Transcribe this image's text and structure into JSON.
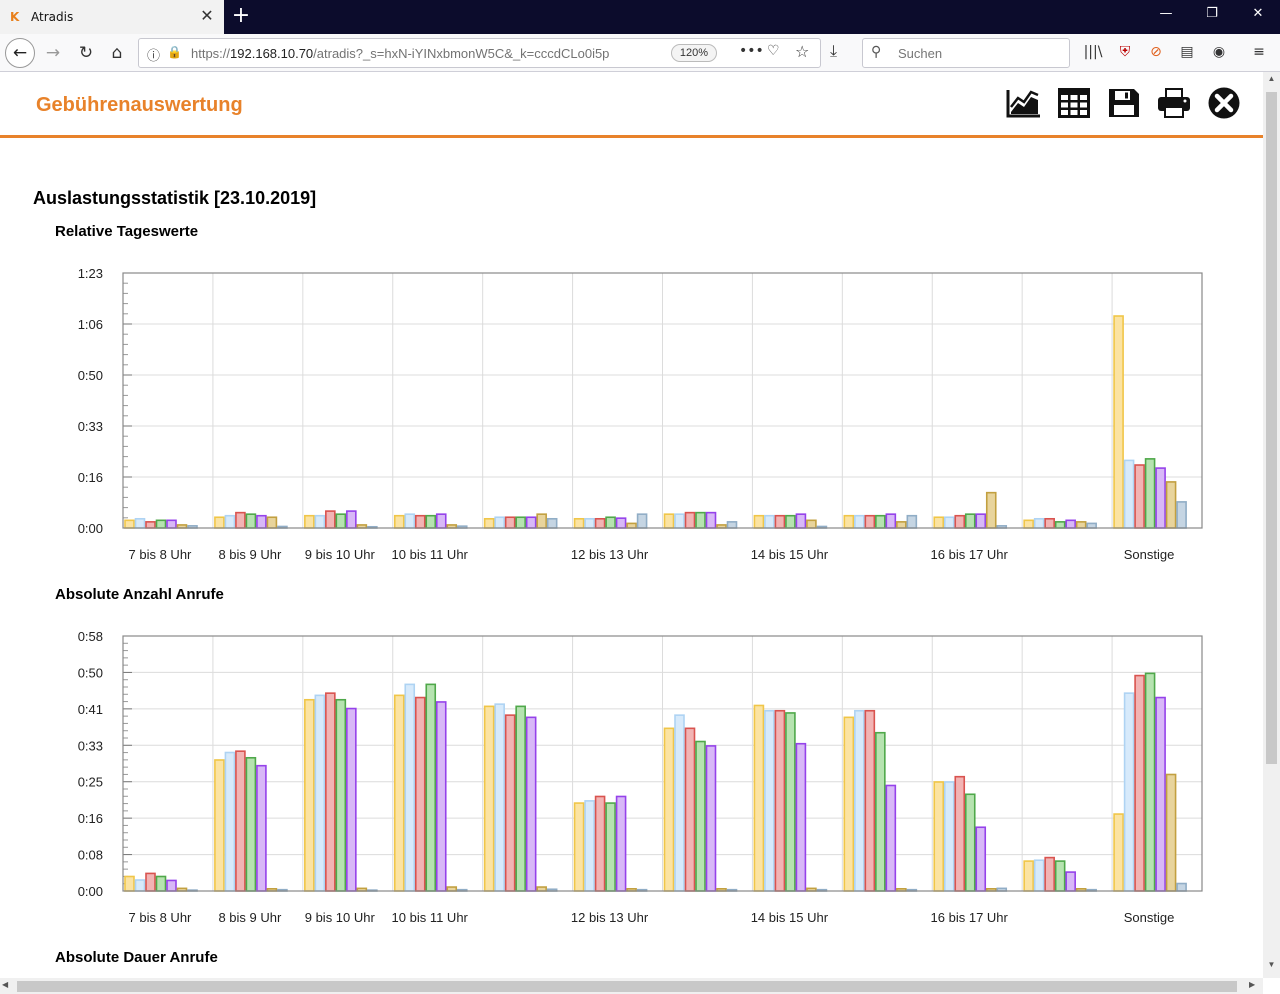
{
  "browser": {
    "tab_title": "Atradis",
    "tab_logo": "K",
    "url_scheme": "https://",
    "url_host": "192.168.10.70",
    "url_rest": "/atradis?_s=hxN-iYINxbmonW5C&_k=cccdCLo0i5p",
    "zoom": "120%",
    "search_placeholder": "Suchen"
  },
  "app": {
    "title": "Gebührenauswertung",
    "toolbar_icons": [
      "chart-icon",
      "table-icon",
      "save-icon",
      "print-icon",
      "close-icon"
    ]
  },
  "page": {
    "heading": "Auslastungsstatistik [23.10.2019]"
  },
  "colors": {
    "series": [
      {
        "fill": "#fbe3a2",
        "stroke": "#f0c648"
      },
      {
        "fill": "#d7eafb",
        "stroke": "#aed3f3"
      },
      {
        "fill": "#f2b4b4",
        "stroke": "#d9534f"
      },
      {
        "fill": "#b6e3b0",
        "stroke": "#4fa84a"
      },
      {
        "fill": "#d8b8f7",
        "stroke": "#9542ea"
      },
      {
        "fill": "#e8d49c",
        "stroke": "#c2a040"
      },
      {
        "fill": "#c5d5e3",
        "stroke": "#90adc6"
      }
    ]
  },
  "chart_data": [
    {
      "type": "bar",
      "title": "Relative Tageswerte",
      "categories": [
        "7 bis 8 Uhr",
        "8 bis 9 Uhr",
        "9 bis 10 Uhr",
        "10 bis 11 Uhr",
        "",
        "12 bis 13 Uhr",
        "",
        "14 bis 15 Uhr",
        "",
        "16 bis 17 Uhr",
        "",
        "Sonstige"
      ],
      "y_ticks": [
        "0:00",
        "0:16",
        "0:33",
        "0:50",
        "1:06",
        "1:23"
      ],
      "ylim": [
        0,
        83
      ],
      "grid": true,
      "series": [
        {
          "values": [
            2.5,
            3.5,
            4,
            4,
            3,
            3,
            4.5,
            4,
            4,
            3.5,
            2.5,
            69
          ]
        },
        {
          "values": [
            3,
            4,
            4,
            4.5,
            3.5,
            3,
            4.5,
            4,
            4,
            3.5,
            3,
            22
          ]
        },
        {
          "values": [
            2,
            5,
            5.5,
            4,
            3.5,
            3,
            5,
            4,
            4,
            4,
            3,
            20.5
          ]
        },
        {
          "values": [
            2.5,
            4.5,
            4.5,
            4,
            3.5,
            3.5,
            5,
            4,
            4,
            4.5,
            2,
            22.5
          ]
        },
        {
          "values": [
            2.5,
            4,
            5.5,
            4.5,
            3.5,
            3.2,
            5,
            4.5,
            4.5,
            4.5,
            2.5,
            19.5
          ]
        },
        {
          "values": [
            1,
            3.5,
            1,
            1,
            4.5,
            1.5,
            1,
            2.5,
            2,
            11.5,
            2,
            15
          ]
        },
        {
          "values": [
            0.7,
            0.5,
            0.4,
            0.6,
            3,
            4.5,
            2,
            0.5,
            4,
            0.7,
            1.5,
            8.5
          ]
        }
      ]
    },
    {
      "type": "bar",
      "title": "Absolute Anzahl Anrufe",
      "categories": [
        "7 bis 8 Uhr",
        "8 bis 9 Uhr",
        "9 bis 10 Uhr",
        "10 bis 11 Uhr",
        "",
        "12 bis 13 Uhr",
        "",
        "14 bis 15 Uhr",
        "",
        "16 bis 17 Uhr",
        "",
        "Sonstige"
      ],
      "y_ticks": [
        "0:00",
        "0:08",
        "0:16",
        "0:25",
        "0:33",
        "0:41",
        "0:50",
        "0:58"
      ],
      "ylim": [
        0,
        58
      ],
      "grid": true,
      "series": [
        {
          "values": [
            3.3,
            29.8,
            43.5,
            44.5,
            42,
            20,
            37,
            42.2,
            39.5,
            24.8,
            6.8,
            17.5
          ]
        },
        {
          "values": [
            2.5,
            31.5,
            44.5,
            47,
            42.5,
            20.5,
            40,
            41,
            41,
            24.8,
            7,
            45
          ]
        },
        {
          "values": [
            4,
            31.8,
            45,
            44,
            40,
            21.5,
            37,
            41,
            41,
            26,
            7.6,
            49
          ]
        },
        {
          "values": [
            3.3,
            30.3,
            43.5,
            47,
            42,
            20,
            34,
            40.5,
            36,
            22,
            6.8,
            49.5
          ]
        },
        {
          "values": [
            2.4,
            28.5,
            41.5,
            43,
            39.5,
            21.5,
            33,
            33.5,
            24,
            14.5,
            4.3,
            44
          ]
        },
        {
          "values": [
            0.6,
            0.5,
            0.6,
            0.9,
            0.9,
            0.5,
            0.5,
            0.6,
            0.5,
            0.5,
            0.5,
            26.5
          ]
        },
        {
          "values": [
            0.2,
            0.3,
            0.2,
            0.3,
            0.4,
            0.3,
            0.3,
            0.3,
            0.3,
            0.6,
            0.3,
            1.7
          ]
        }
      ]
    }
  ],
  "next_section": {
    "heading": "Absolute Dauer Anrufe"
  }
}
